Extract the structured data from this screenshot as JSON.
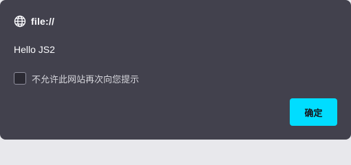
{
  "dialog": {
    "origin": "file://",
    "origin_icon": "globe-icon",
    "message": "Hello JS2",
    "checkbox_label": "不允许此网站再次向您提示",
    "checkbox_checked": false,
    "ok_label": "确定"
  },
  "colors": {
    "dialog_background": "#42414d",
    "text": "#fbfbfe",
    "button_accent": "#00ddff",
    "button_text": "#15141a"
  }
}
